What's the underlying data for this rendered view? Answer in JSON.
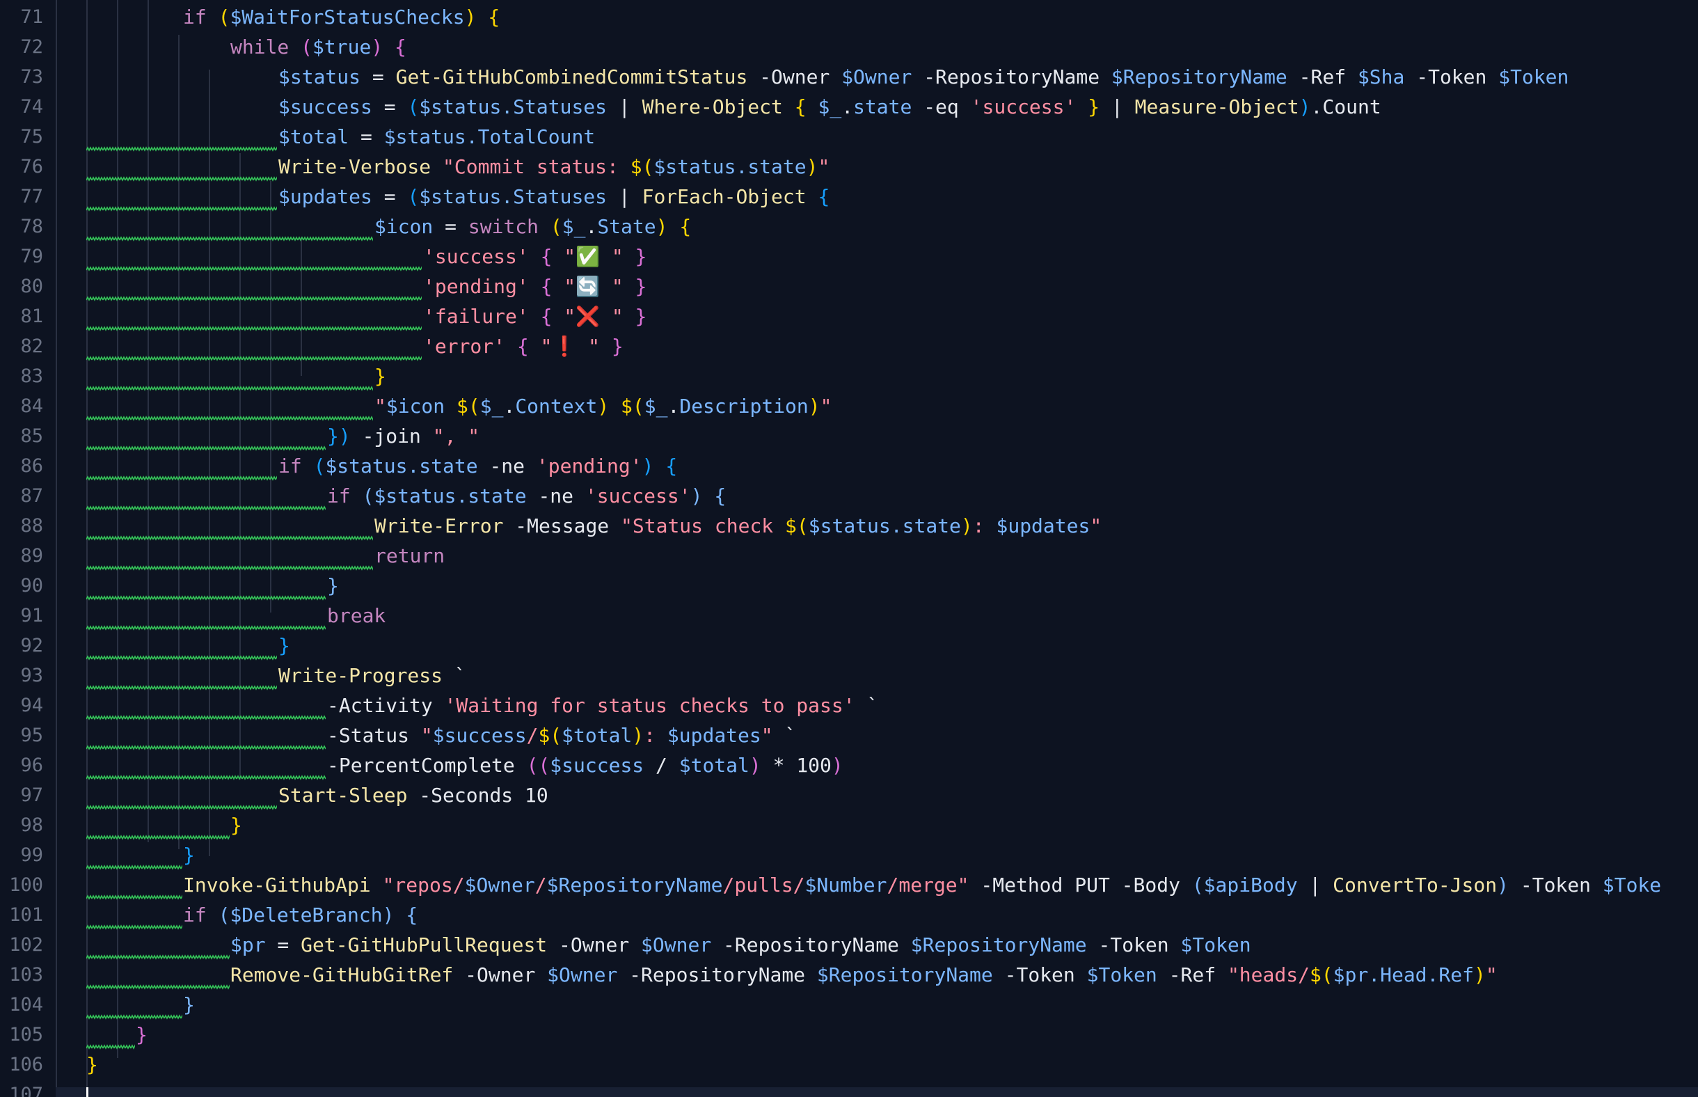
{
  "editor": {
    "line_numbers": [
      "71",
      "72",
      "73",
      "74",
      "75",
      "76",
      "77",
      "78",
      "79",
      "80",
      "81",
      "82",
      "83",
      "84",
      "85",
      "86",
      "87",
      "88",
      "89",
      "90",
      "91",
      "92",
      "93",
      "94",
      "95",
      "96",
      "97",
      "98",
      "99",
      "100",
      "101",
      "102",
      "103",
      "104",
      "105",
      "106",
      "107"
    ],
    "lines": [
      "if ($WaitForStatusChecks) {",
      "while ($true) {",
      "$status = Get-GitHubCombinedCommitStatus -Owner $Owner -RepositoryName $RepositoryName -Ref $Sha -Token $Token",
      "$success = ($status.Statuses | Where-Object { $_.state -eq 'success' } | Measure-Object).Count",
      "$total = $status.TotalCount",
      "Write-Verbose \"Commit status: $($status.state)\"",
      "$updates = ($status.Statuses | ForEach-Object {",
      "$icon = switch ($_.State) {",
      "'success' { \"✅ \" }",
      "'pending' { \"🔄 \" }",
      "'failure' { \"❌ \" }",
      "'error' { \"❗ \" }",
      "}",
      "\"$icon $($_.Context) $($_.Description)\"",
      "}) -join \", \"",
      "if ($status.state -ne 'pending') {",
      "if ($status.state -ne 'success') {",
      "Write-Error -Message \"Status check $($status.state): $updates\"",
      "return",
      "}",
      "break",
      "}",
      "Write-Progress `",
      "-Activity 'Waiting for status checks to pass' `",
      "-Status \"$success/$($total): $updates\" `",
      "-PercentComplete (($success / $total) * 100)",
      "Start-Sleep -Seconds 10",
      "}",
      "}",
      "Invoke-GithubApi \"repos/$Owner/$RepositoryName/pulls/$Number/merge\" -Method PUT -Body ($apiBody | ConvertTo-Json) -Token $Toke",
      "if ($DeleteBranch) {",
      "$pr = Get-GitHubPullRequest -Owner $Owner -RepositoryName $RepositoryName -Token $Token",
      "Remove-GitHubGitRef -Owner $Owner -RepositoryName $RepositoryName -Token $Token -Ref \"heads/$($pr.Head.Ref)\"",
      "}",
      "}",
      "}",
      ""
    ]
  },
  "colors": {
    "background": "#0d1321",
    "keyword": "#c586c0",
    "function": "#f5e6a8",
    "variable": "#7cb7ff",
    "string": "#ff8fa3",
    "squiggle": "#34c759",
    "line_number": "#6b7385"
  }
}
